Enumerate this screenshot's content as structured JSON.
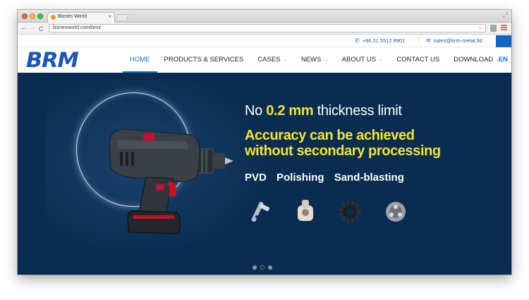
{
  "browser": {
    "tab_title": "Biznes World",
    "url": "biznesworld.com/brm/",
    "tab_close_glyph": "×"
  },
  "topbar": {
    "phone": "+86 21 5512 8901",
    "email": "sales@brm-metal.ltd"
  },
  "nav": {
    "logo": "BRM",
    "items": [
      {
        "label": "HOME",
        "active": true,
        "dropdown": false
      },
      {
        "label": "PRODUCTS & SERVICES",
        "active": false,
        "dropdown": false
      },
      {
        "label": "CASES",
        "active": false,
        "dropdown": true
      },
      {
        "label": "NEWS",
        "active": false,
        "dropdown": true
      },
      {
        "label": "ABOUT US",
        "active": false,
        "dropdown": true
      },
      {
        "label": "CONTACT US",
        "active": false,
        "dropdown": false
      },
      {
        "label": "DOWNLOAD",
        "active": false,
        "dropdown": true
      }
    ],
    "lang": "EN"
  },
  "hero": {
    "line1_prefix": "No ",
    "line1_accent": "0.2 mm",
    "line1_suffix": " thickness limit",
    "line2a": "Accuracy can be achieved",
    "line2b": "without secondary processing",
    "processes": [
      "PVD",
      "Polishing",
      "Sand-blasting"
    ],
    "slides": 3,
    "active_slide": 1
  },
  "colors": {
    "brand_blue": "#1a56b8",
    "hero_bg": "#0a2c50",
    "accent_yellow": "#f4e62a"
  }
}
